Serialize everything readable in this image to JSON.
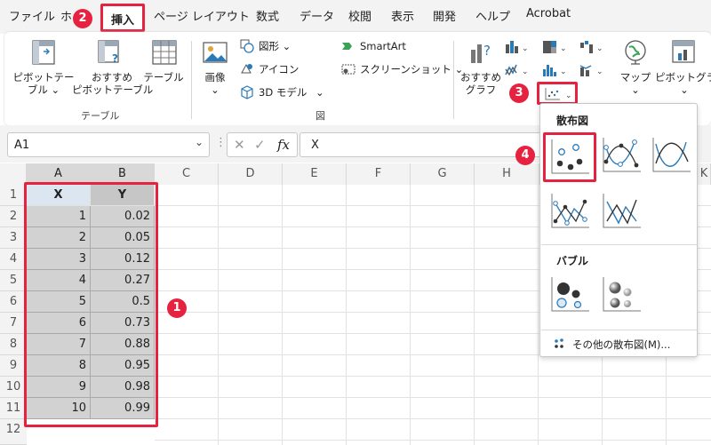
{
  "menu": {
    "tabs": [
      "ファイル",
      "ホ",
      "挿入",
      "ページ レイアウト",
      "数式",
      "データ",
      "校閲",
      "表示",
      "開発",
      "ヘルプ",
      "Acrobat"
    ],
    "selected": "挿入"
  },
  "ribbon": {
    "table_group": {
      "label": "テーブル",
      "pivot": "ピボットテー\nブル ⌄",
      "recommended_pivot": "おすすめ\nピボットテーブル",
      "table": "テーブル"
    },
    "illustrations_group": {
      "label": "図",
      "image": "画像\n⌄",
      "shapes": "図形 ⌄",
      "icons": "アイコン",
      "model3d": "3D モデル",
      "smartart": "SmartArt",
      "screenshot": "スクリーンショット ⌄"
    },
    "charts_group": {
      "recommended": "おすすめ\nグラフ",
      "map": "マップ\n⌄",
      "pivot_chart": "ピボットグラフ\n⌄"
    }
  },
  "formula_bar": {
    "name_box": "A1",
    "formula": "X",
    "fx_label": "fx"
  },
  "grid": {
    "columns": [
      "A",
      "B",
      "C",
      "D",
      "E",
      "F",
      "G",
      "H",
      "K"
    ],
    "rows": [
      "1",
      "2",
      "3",
      "4",
      "5",
      "6",
      "7",
      "8",
      "9",
      "10",
      "11",
      "12"
    ],
    "header": [
      "X",
      "Y"
    ],
    "data": [
      [
        "1",
        "0.02"
      ],
      [
        "2",
        "0.05"
      ],
      [
        "3",
        "0.12"
      ],
      [
        "4",
        "0.27"
      ],
      [
        "5",
        "0.5"
      ],
      [
        "6",
        "0.73"
      ],
      [
        "7",
        "0.88"
      ],
      [
        "8",
        "0.95"
      ],
      [
        "9",
        "0.98"
      ],
      [
        "10",
        "0.99"
      ]
    ]
  },
  "dropdown": {
    "scatter_title": "散布図",
    "bubble_title": "バブル",
    "more": "その他の散布図(M)..."
  },
  "badges": [
    "1",
    "2",
    "3",
    "4"
  ],
  "colors": {
    "accent": "#e5223f",
    "selection": "#d2d2d2",
    "header_a": "#dce6f1"
  }
}
